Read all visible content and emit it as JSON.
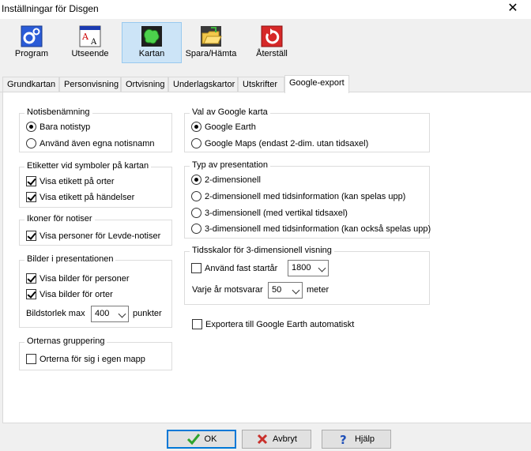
{
  "window": {
    "title": "Inställningar för Disgen",
    "close_glyph": "✕"
  },
  "toolbar": [
    {
      "key": "program",
      "label": "Program",
      "icon": "gear-icon"
    },
    {
      "key": "utseende",
      "label": "Utseende",
      "icon": "font-icon"
    },
    {
      "key": "kartan",
      "label": "Kartan",
      "icon": "map-icon",
      "selected": true
    },
    {
      "key": "spara",
      "label": "Spara/Hämta",
      "icon": "folder-icon"
    },
    {
      "key": "aterstall",
      "label": "Återställ",
      "icon": "reset-icon"
    }
  ],
  "tabs": [
    "Grundkartan",
    "Personvisning",
    "Ortvisning",
    "Underlagskartor",
    "Utskrifter",
    "Google-export"
  ],
  "active_tab": "Google-export",
  "left": {
    "notis": {
      "legend": "Notisbenämning",
      "options": [
        "Bara notistyp",
        "Använd även egna notisnamn"
      ],
      "selected": 0
    },
    "etiketter": {
      "legend": "Etiketter vid symboler på kartan",
      "items": [
        {
          "label": "Visa etikett på orter",
          "checked": true
        },
        {
          "label": "Visa etikett på händelser",
          "checked": true
        }
      ]
    },
    "ikoner": {
      "legend": "Ikoner för notiser",
      "items": [
        {
          "label": "Visa personer för Levde-notiser",
          "checked": true
        }
      ]
    },
    "bilder": {
      "legend": "Bilder i presentationen",
      "items": [
        {
          "label": "Visa bilder för personer",
          "checked": true
        },
        {
          "label": "Visa bilder för orter",
          "checked": true
        }
      ],
      "size_label": "Bildstorlek  max",
      "size_value": "400",
      "size_unit": "punkter"
    },
    "gruppering": {
      "legend": "Orternas gruppering",
      "items": [
        {
          "label": "Orterna för sig i egen mapp",
          "checked": false
        }
      ]
    }
  },
  "right": {
    "karta": {
      "legend": "Val av Google karta",
      "options": [
        "Google Earth",
        "Google Maps (endast 2-dim. utan tidsaxel)"
      ],
      "selected": 0
    },
    "presentation": {
      "legend": "Typ av presentation",
      "options": [
        "2-dimensionell",
        "2-dimensionell med tidsinformation (kan spelas upp)",
        "3-dimensionell (med vertikal tidsaxel)",
        "3-dimensionell med tidsinformation (kan också spelas upp)"
      ],
      "selected": 0
    },
    "tidsskalor": {
      "legend": "Tidsskalor för 3-dimensionell visning",
      "fixed_label": "Använd fast startår",
      "fixed_checked": false,
      "start_year": "1800",
      "per_year_label": "Varje år motsvarar",
      "per_year_value": "50",
      "per_year_unit": "meter"
    },
    "export_auto": {
      "label": "Exportera till Google Earth automatiskt",
      "checked": false
    }
  },
  "footer": {
    "ok": "OK",
    "cancel": "Avbryt",
    "help": "Hjälp"
  },
  "colors": {
    "selected_bg": "#cce4f7",
    "accent": "#0078d7",
    "ok_check": "#2ea32e",
    "cancel_x": "#c9302c"
  }
}
